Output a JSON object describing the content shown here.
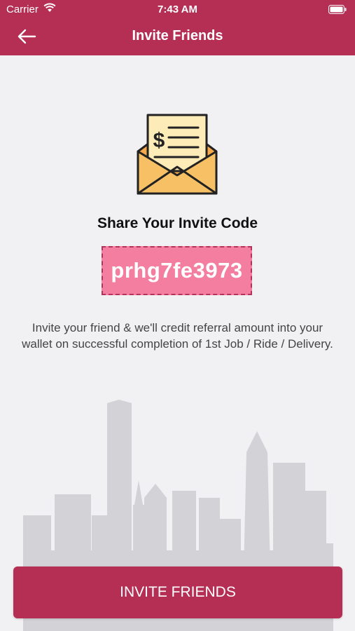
{
  "status_bar": {
    "carrier": "Carrier",
    "time": "7:43 AM",
    "icons": [
      "wifi-icon",
      "battery-icon"
    ]
  },
  "header": {
    "title": "Invite Friends",
    "back_icon": "arrow-left-icon"
  },
  "illustration": {
    "icon": "envelope-invoice-icon",
    "symbol": "$"
  },
  "invite": {
    "heading": "Share Your Invite Code",
    "code": "prhg7fe3973",
    "description": "Invite your friend & we'll credit referral amount into your wallet on successful completion of 1st Job / Ride / Delivery."
  },
  "actions": {
    "invite_button": "INVITE FRIENDS"
  },
  "colors": {
    "primary": "#b52f55",
    "code_background": "#f47e9f",
    "page_background": "#f1f1f4",
    "skyline": "#d3d3d8"
  }
}
